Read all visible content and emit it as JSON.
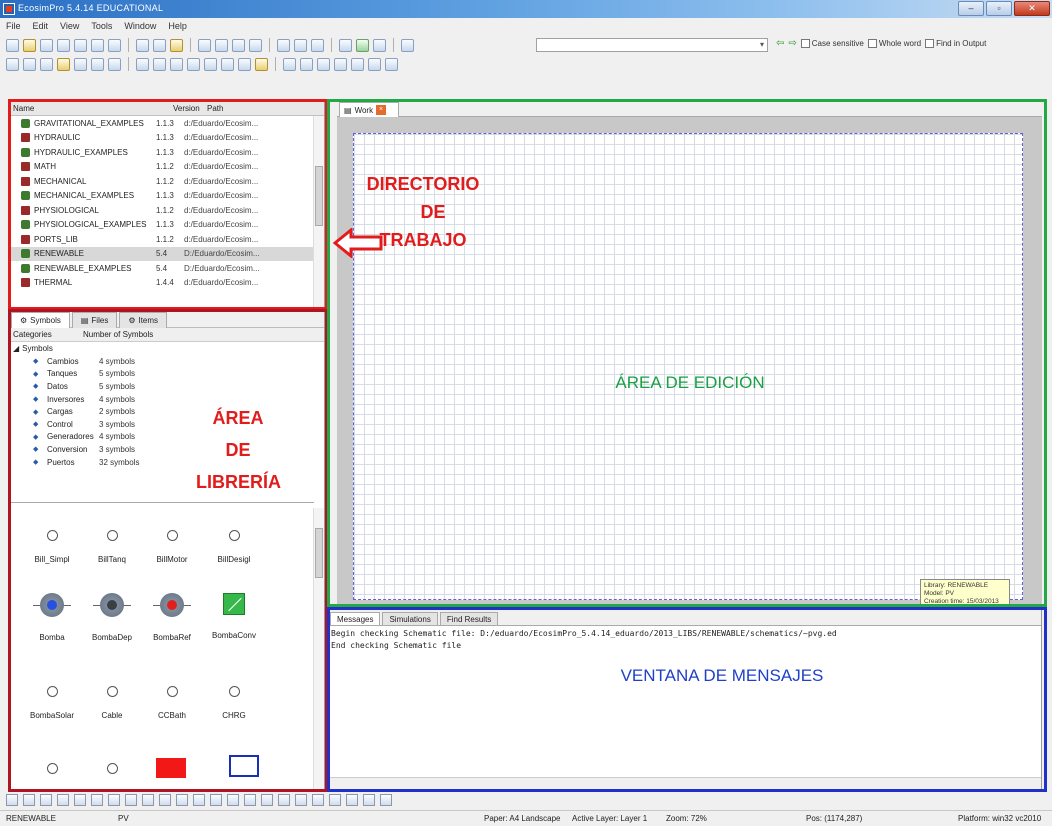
{
  "window": {
    "title": "EcosimPro 5.4.14 EDUCATIONAL",
    "buttons": [
      "–",
      "▫",
      "✕"
    ]
  },
  "menu": [
    "File",
    "Edit",
    "View",
    "Tools",
    "Window",
    "Help"
  ],
  "find": {
    "options": [
      "Case sensitive",
      "Whole word",
      "Find in Output"
    ]
  },
  "directory": {
    "columns": [
      "Name",
      "Version",
      "Path"
    ],
    "rows": [
      {
        "name": "GRAVITATIONAL_EXAMPLES",
        "version": "1.1.3",
        "path": "d:/Eduardo/Ecosim...",
        "type": "lib"
      },
      {
        "name": "HYDRAULIC",
        "version": "1.1.3",
        "path": "d:/Eduardo/Ecosim...",
        "type": "pkg"
      },
      {
        "name": "HYDRAULIC_EXAMPLES",
        "version": "1.1.3",
        "path": "d:/Eduardo/Ecosim...",
        "type": "lib"
      },
      {
        "name": "MATH",
        "version": "1.1.2",
        "path": "d:/Eduardo/Ecosim...",
        "type": "pkg"
      },
      {
        "name": "MECHANICAL",
        "version": "1.1.2",
        "path": "d:/Eduardo/Ecosim...",
        "type": "pkg"
      },
      {
        "name": "MECHANICAL_EXAMPLES",
        "version": "1.1.3",
        "path": "d:/Eduardo/Ecosim...",
        "type": "lib"
      },
      {
        "name": "PHYSIOLOGICAL",
        "version": "1.1.2",
        "path": "d:/Eduardo/Ecosim...",
        "type": "pkg"
      },
      {
        "name": "PHYSIOLOGICAL_EXAMPLES",
        "version": "1.1.3",
        "path": "d:/Eduardo/Ecosim...",
        "type": "lib"
      },
      {
        "name": "PORTS_LIB",
        "version": "1.1.2",
        "path": "d:/Eduardo/Ecosim...",
        "type": "pkg"
      },
      {
        "name": "RENEWABLE",
        "version": "5.4",
        "path": "D:/Eduardo/Ecosim...",
        "type": "lib",
        "selected": true
      },
      {
        "name": "RENEWABLE_EXAMPLES",
        "version": "5.4",
        "path": "D:/Eduardo/Ecosim...",
        "type": "lib"
      },
      {
        "name": "THERMAL",
        "version": "1.4.4",
        "path": "d:/Eduardo/Ecosim...",
        "type": "pkg"
      }
    ]
  },
  "library": {
    "tabs": [
      "Symbols",
      "Files",
      "Items"
    ],
    "columns": [
      "Categories",
      "Number of Symbols"
    ],
    "root": "Symbols",
    "categories": [
      {
        "name": "Cambios",
        "count": "4 symbols"
      },
      {
        "name": "Tanques",
        "count": "5 symbols"
      },
      {
        "name": "Datos",
        "count": "5 symbols"
      },
      {
        "name": "Inversores",
        "count": "4 symbols"
      },
      {
        "name": "Cargas",
        "count": "2 symbols"
      },
      {
        "name": "Control",
        "count": "3 symbols"
      },
      {
        "name": "Generadores",
        "count": "4 symbols"
      },
      {
        "name": "Conversion",
        "count": "3 symbols"
      },
      {
        "name": "Puertos",
        "count": "32 symbols"
      }
    ],
    "symbols_row1": [
      "Bill_Simpl",
      "BillTanq",
      "BillMotor",
      "BillDesigl"
    ],
    "symbols_row2": [
      "Bomba",
      "BombaDep",
      "BombaRef",
      "BombaConv"
    ],
    "symbols_row3": [
      "BombaSolar",
      "Cable",
      "CCBath",
      "CHRG"
    ]
  },
  "editor": {
    "tab": "Work",
    "titleblock": [
      "Library: RENEWABLE",
      "Model: PV",
      "Creation time: 15/03/2013"
    ]
  },
  "messages": {
    "tabs": [
      "Messages",
      "Simulations",
      "Find Results"
    ],
    "lines": [
      "Begin checking Schematic file: D:/eduardo/EcosimPro_5.4.14_eduardo/2013_LIBS/RENEWABLE/schematics/~pvg.ed",
      "End checking Schematic file"
    ]
  },
  "statusbar": {
    "library": "RENEWABLE",
    "model": "PV",
    "paper": "Paper: A4 Landscape",
    "layer": "Active Layer: Layer 1",
    "zoom": "Zoom: 72%",
    "pos": "Pos: (1174,287)",
    "platform": "Platform: win32 vc2010"
  },
  "annotations": {
    "directorio": [
      "DIRECTORIO",
      "DE",
      "TRABAJO"
    ],
    "libreria": [
      "ÁREA",
      "DE",
      "LIBRERÍA"
    ],
    "edicion": "ÁREA DE EDICIÓN",
    "mensajes": "VENTANA DE MENSAJES"
  },
  "colors": {
    "red_box": "#e21b1b",
    "dark_red_box": "#b01424",
    "green_box": "#23a845",
    "blue_box": "#2030c8"
  }
}
